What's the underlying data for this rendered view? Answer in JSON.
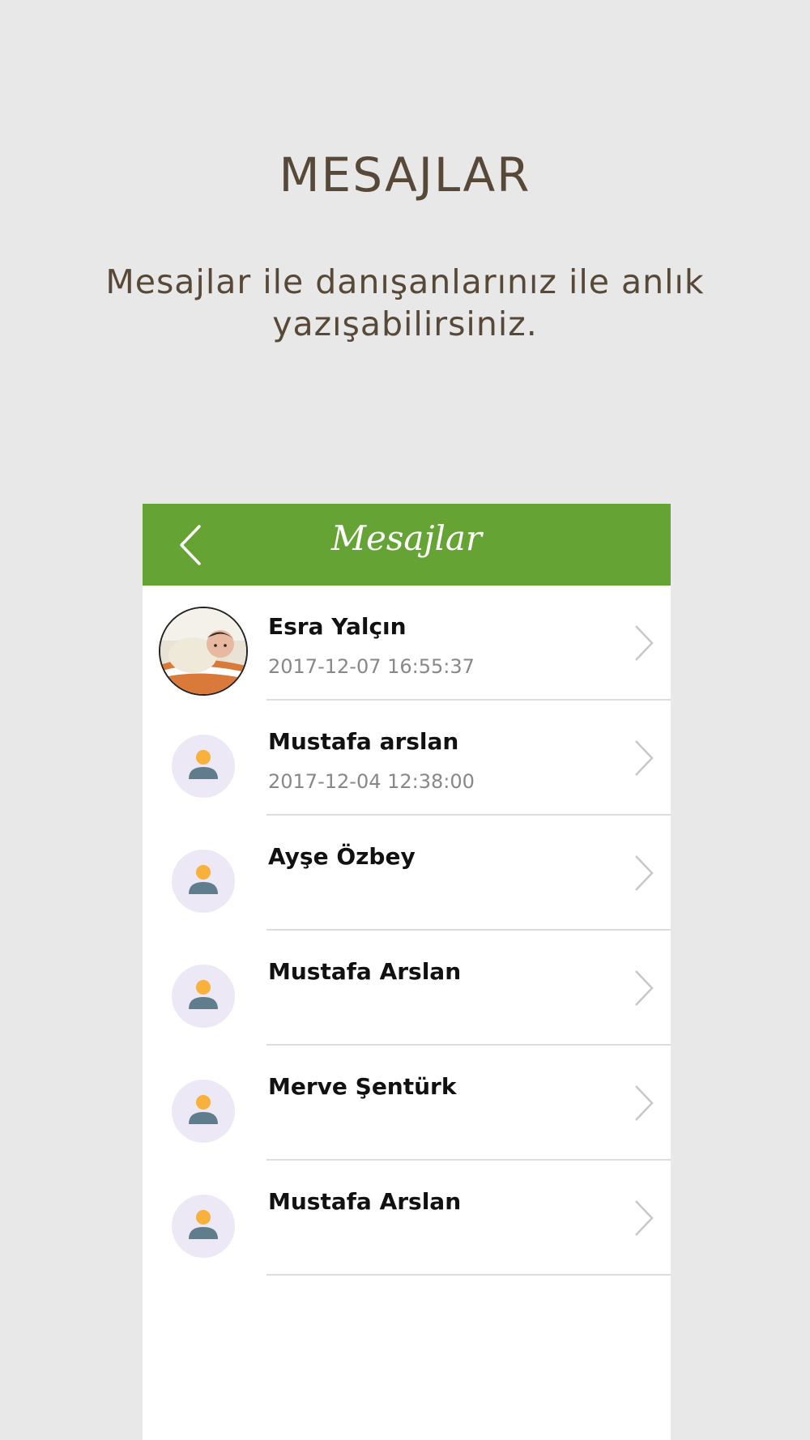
{
  "promo": {
    "title": "MESAJLAR",
    "subtitle": "Mesajlar ile danışanlarınız ile anlık yazışabilirsiniz."
  },
  "header": {
    "title": "Mesajlar",
    "back_icon": "chevron-left-icon",
    "color": "#65a335"
  },
  "conversations": [
    {
      "name": "Esra Yalçın",
      "time": "2017-12-07 16:55:37",
      "avatar": "photo"
    },
    {
      "name": "Mustafa arslan",
      "time": "2017-12-04 12:38:00",
      "avatar": "default-user-icon"
    },
    {
      "name": "Ayşe Özbey",
      "time": "",
      "avatar": "default-user-icon"
    },
    {
      "name": "Mustafa Arslan",
      "time": "",
      "avatar": "default-user-icon"
    },
    {
      "name": "Merve Şentürk",
      "time": "",
      "avatar": "default-user-icon"
    },
    {
      "name": "Mustafa Arslan",
      "time": "",
      "avatar": "default-user-icon"
    }
  ]
}
